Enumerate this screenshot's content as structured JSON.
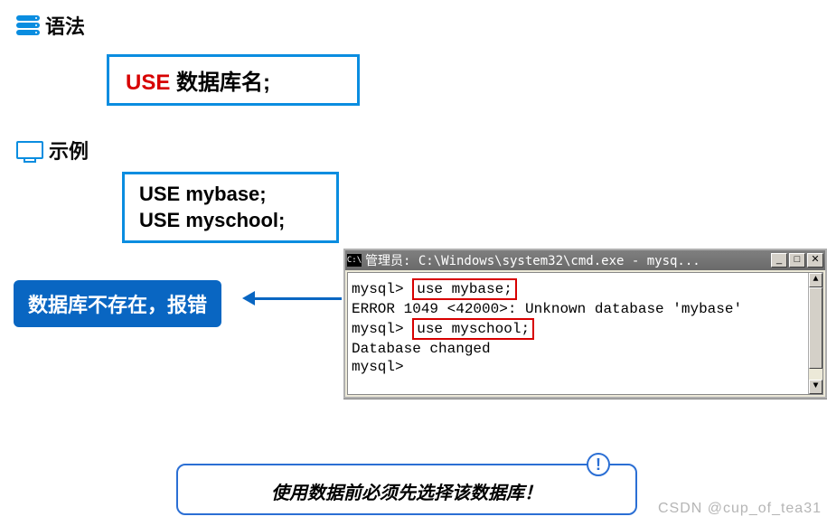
{
  "sections": {
    "syntax_label": "语法",
    "example_label": "示例"
  },
  "syntax": {
    "keyword": "USE",
    "rest": " 数据库名;"
  },
  "example": {
    "line1": "USE mybase;",
    "line2": "USE myschool;"
  },
  "callout": {
    "text": "数据库不存在，报错"
  },
  "cmd": {
    "title_icon": "C:\\",
    "title": "管理员: C:\\Windows\\system32\\cmd.exe - mysq...",
    "btn_min": "_",
    "btn_max": "□",
    "btn_close": "✕",
    "lines": {
      "p1_prompt": "mysql>",
      "p1_cmd": "use mybase;",
      "l2": "ERROR 1049 <42000>: Unknown database 'mybase'",
      "p3_prompt": "mysql>",
      "p3_cmd": "use myschool;",
      "l4": "Database changed",
      "l5": "mysql>"
    },
    "scroll_up": "▲",
    "scroll_down": "▼"
  },
  "bottom_note": {
    "badge": "!",
    "text": "使用数据前必须先选择该数据库！"
  },
  "watermark": "CSDN @cup_of_tea31"
}
